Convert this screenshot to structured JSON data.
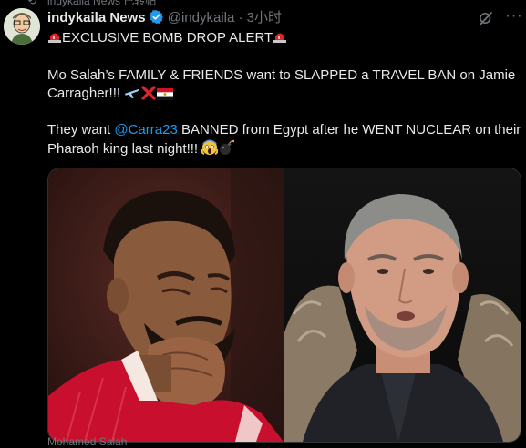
{
  "context": {
    "label": "indykaila News 已转帖"
  },
  "tweet": {
    "display_name": "indykaila News",
    "handle": "@indykaila",
    "separator": "·",
    "time": "3小时",
    "line1": "EXCLUSIVE BOMB DROP ALERT",
    "line2": "Mo Salah’s FAMILY & FRIENDS want to SLAPPED a TRAVEL BAN on Jamie Carragher!!! ",
    "line3_pre": "They want ",
    "mention": "@Carra23",
    "line3_post": " BANNED from Egypt after he WENT NUCLEAR on their Pharaoh king last night!!! "
  },
  "media": {
    "left_caption": "Mohamed Salah"
  },
  "colors": {
    "background": "#000000",
    "text": "#e7e9ea",
    "muted": "#71767b",
    "link": "#1d9bf0",
    "verified": "#1d9bf0"
  },
  "icons": [
    "repost-icon",
    "verified-badge-icon",
    "grok-icon",
    "more-icon",
    "siren-icon",
    "airplane-icon",
    "cross-mark-icon",
    "egypt-flag-icon",
    "screaming-face-icon",
    "bomb-icon"
  ]
}
